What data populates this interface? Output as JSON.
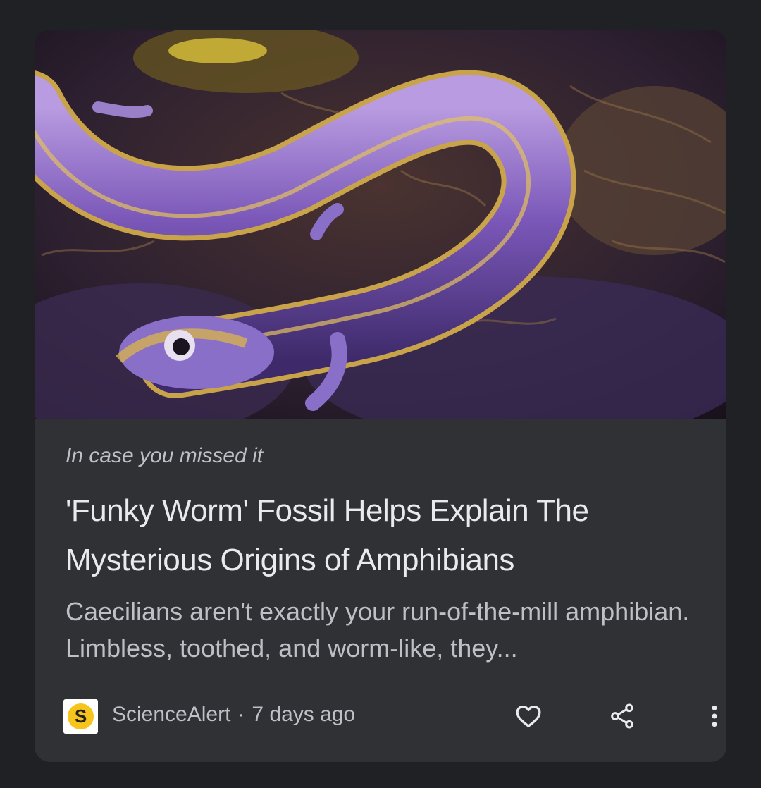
{
  "card": {
    "image_alt": "Illustration of a purple caecilian-like amphibian",
    "kicker": "In case you missed it",
    "headline": "'Funky Worm' Fossil Helps Explain The Mysterious Origins of Amphibians",
    "snippet": "Caecilians aren't exactly your run-of-the-mill amphibian. Limbless, toothed, and worm-like, they...",
    "source": {
      "logo_letter": "S",
      "name": "ScienceAlert",
      "separator": "·",
      "age": "7 days ago"
    },
    "actions": {
      "like_icon": "heart-outline-icon",
      "share_icon": "share-icon",
      "more_icon": "more-vertical-icon"
    }
  },
  "colors": {
    "page_bg": "#202124",
    "card_bg": "#303134",
    "headline": "#e8eaed",
    "secondary_text": "#bdc1c6",
    "logo_yellow": "#f7c41b"
  }
}
